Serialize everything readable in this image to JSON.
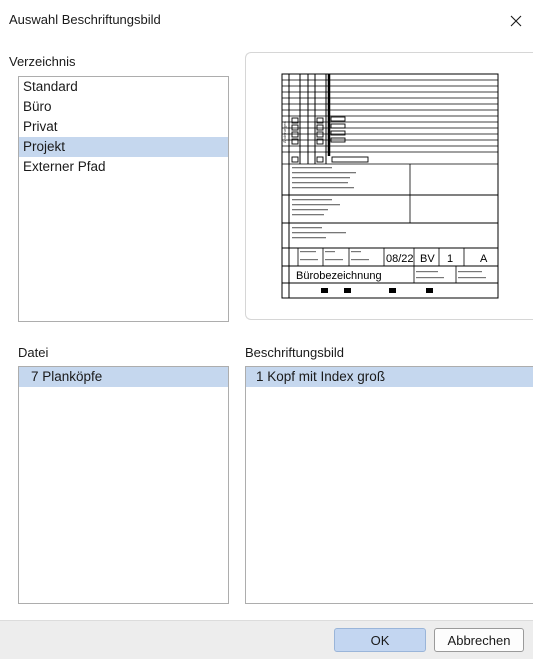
{
  "window": {
    "title": "Auswahl Beschriftungsbild"
  },
  "verzeichnis": {
    "label": "Verzeichnis",
    "items": [
      "Standard",
      "Büro",
      "Privat",
      "Projekt",
      "Externer Pfad"
    ],
    "selected": "Projekt"
  },
  "datei": {
    "label": "Datei",
    "items": [
      "7 Planköpfe"
    ],
    "selected": "7 Planköpfe"
  },
  "beschriftungsbild": {
    "label": "Beschriftungsbild",
    "items": [
      "1 Kopf mit Index groß"
    ],
    "selected": "1 Kopf mit Index groß"
  },
  "preview": {
    "date_code": "08/22",
    "code_bv": "BV",
    "number": "1",
    "index": "A",
    "buerobezeichnung": "Bürobezeichnung"
  },
  "buttons": {
    "ok": "OK",
    "cancel": "Abbrechen"
  },
  "colors": {
    "selection": "#c5d7ee",
    "footer": "#ededed",
    "ok_button": "#c3d6f1"
  }
}
